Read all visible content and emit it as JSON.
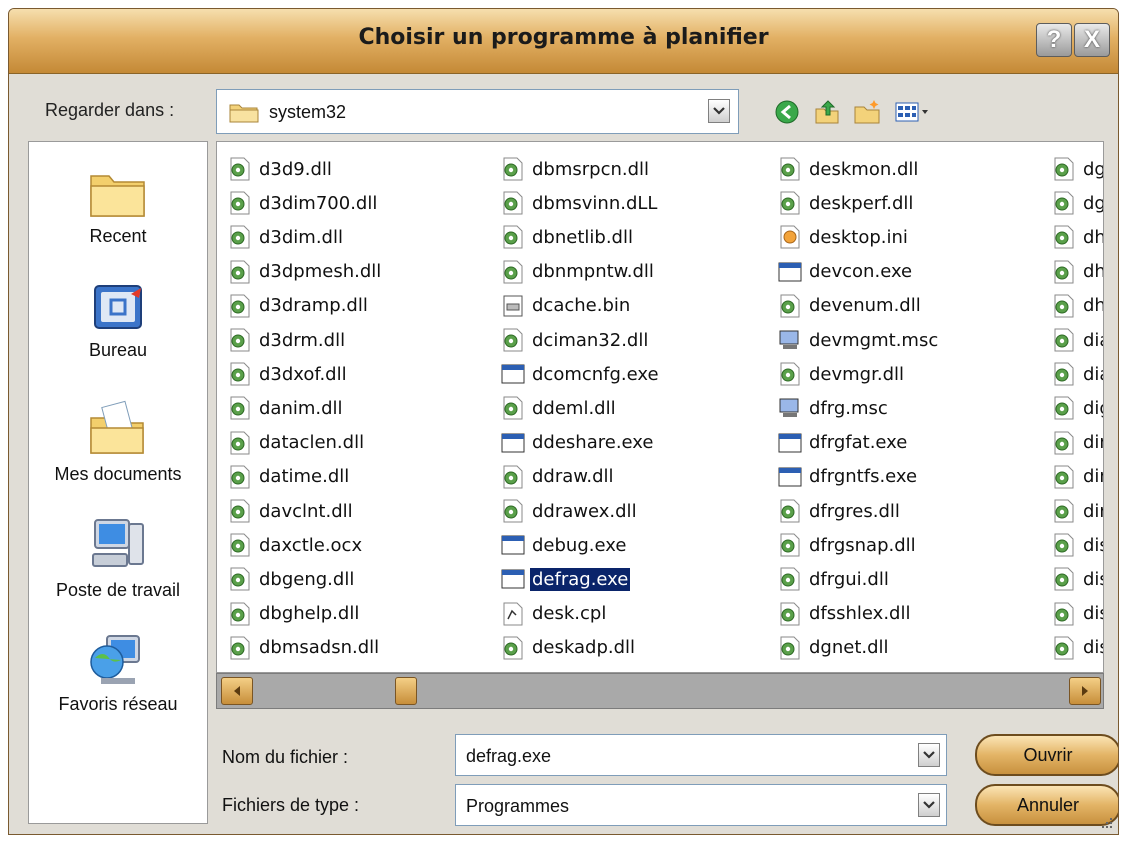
{
  "window": {
    "title": "Choisir un programme à planifier",
    "help_label": "?",
    "close_label": "X"
  },
  "lookin": {
    "label": "Regarder dans :",
    "value": "system32"
  },
  "places": [
    {
      "label": "Recent",
      "icon": "recent-folder-icon"
    },
    {
      "label": "Bureau",
      "icon": "desktop-icon"
    },
    {
      "label": "Mes documents",
      "icon": "my-documents-icon"
    },
    {
      "label": "Poste de travail",
      "icon": "my-computer-icon"
    },
    {
      "label": "Favoris réseau",
      "icon": "network-places-icon"
    }
  ],
  "files": {
    "col1": [
      "d3d9.dll",
      "d3dim700.dll",
      "d3dim.dll",
      "d3dpmesh.dll",
      "d3dramp.dll",
      "d3drm.dll",
      "d3dxof.dll",
      "danim.dll",
      "dataclen.dll",
      "datime.dll",
      "davclnt.dll",
      "daxctle.ocx",
      "dbgeng.dll",
      "dbghelp.dll",
      "dbmsadsn.dll"
    ],
    "col2": [
      "dbmsrpcn.dll",
      "dbmsvinn.dLL",
      "dbnetlib.dll",
      "dbnmpntw.dll",
      "dcache.bin",
      "dciman32.dll",
      "dcomcnfg.exe",
      "ddeml.dll",
      "ddeshare.exe",
      "ddraw.dll",
      "ddrawex.dll",
      "debug.exe",
      "defrag.exe",
      "desk.cpl",
      "deskadp.dll"
    ],
    "col3": [
      "deskmon.dll",
      "deskperf.dll",
      "desktop.ini",
      "devcon.exe",
      "devenum.dll",
      "devmgmt.msc",
      "devmgr.dll",
      "dfrg.msc",
      "dfrgfat.exe",
      "dfrgntfs.exe",
      "dfrgres.dll",
      "dfrgsnap.dll",
      "dfrgui.dll",
      "dfsshlex.dll",
      "dgnet.dll"
    ],
    "col4": [
      "dgrp",
      "dgs",
      "dhc",
      "dhc",
      "dhc",
      "diac",
      "diar",
      "dige",
      "dim.",
      "dinp",
      "dinp",
      "disk",
      "disk",
      "disk",
      "disk"
    ],
    "selected": "defrag.exe"
  },
  "filename": {
    "label": "Nom du fichier :",
    "value": "defrag.exe"
  },
  "filetype": {
    "label": "Fichiers de type :",
    "value": "Programmes"
  },
  "buttons": {
    "open": "Ouvrir",
    "cancel": "Annuler"
  },
  "colors": {
    "titlebar": "#e2b064",
    "selection": "#0a246a",
    "dll_icon": "#5aa04a"
  }
}
